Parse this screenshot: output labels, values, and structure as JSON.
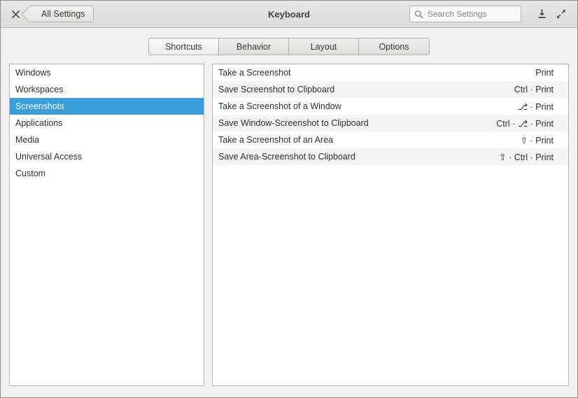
{
  "window": {
    "title": "Keyboard",
    "close_label": "✕"
  },
  "header": {
    "back_button_label": "All Settings",
    "search": {
      "placeholder": "Search Settings",
      "value": "",
      "icon": "search-icon"
    },
    "minimize_icon": "download-arrow-icon",
    "maximize_icon": "expand-arrows-icon"
  },
  "tabs": [
    {
      "label": "Shortcuts",
      "active": true
    },
    {
      "label": "Behavior",
      "active": false
    },
    {
      "label": "Layout",
      "active": false
    },
    {
      "label": "Options",
      "active": false
    }
  ],
  "categories": [
    {
      "label": "Windows",
      "selected": false
    },
    {
      "label": "Workspaces",
      "selected": false
    },
    {
      "label": "Screenshots",
      "selected": true
    },
    {
      "label": "Applications",
      "selected": false
    },
    {
      "label": "Media",
      "selected": false
    },
    {
      "label": "Universal Access",
      "selected": false
    },
    {
      "label": "Custom",
      "selected": false
    }
  ],
  "shortcuts": [
    {
      "name": "Take a Screenshot",
      "keys": "Print"
    },
    {
      "name": "Save Screenshot to Clipboard",
      "keys": "Ctrl · Print"
    },
    {
      "name": "Take a Screenshot of a Window",
      "keys": "⎇ · Print"
    },
    {
      "name": "Save Window-Screenshot to Clipboard",
      "keys": "Ctrl · ⎇ · Print"
    },
    {
      "name": "Take a Screenshot of an Area",
      "keys": "⇧ · Print"
    },
    {
      "name": "Save Area-Screenshot to Clipboard",
      "keys": "⇧ · Ctrl · Print"
    }
  ],
  "colors": {
    "selection": "#3c9ddb",
    "window_bg": "#f2f1f0",
    "pane_bg": "#ffffff",
    "row_alt_bg": "#f6f5f4",
    "border": "#b8b5b0",
    "text": "#2e2e2b"
  }
}
